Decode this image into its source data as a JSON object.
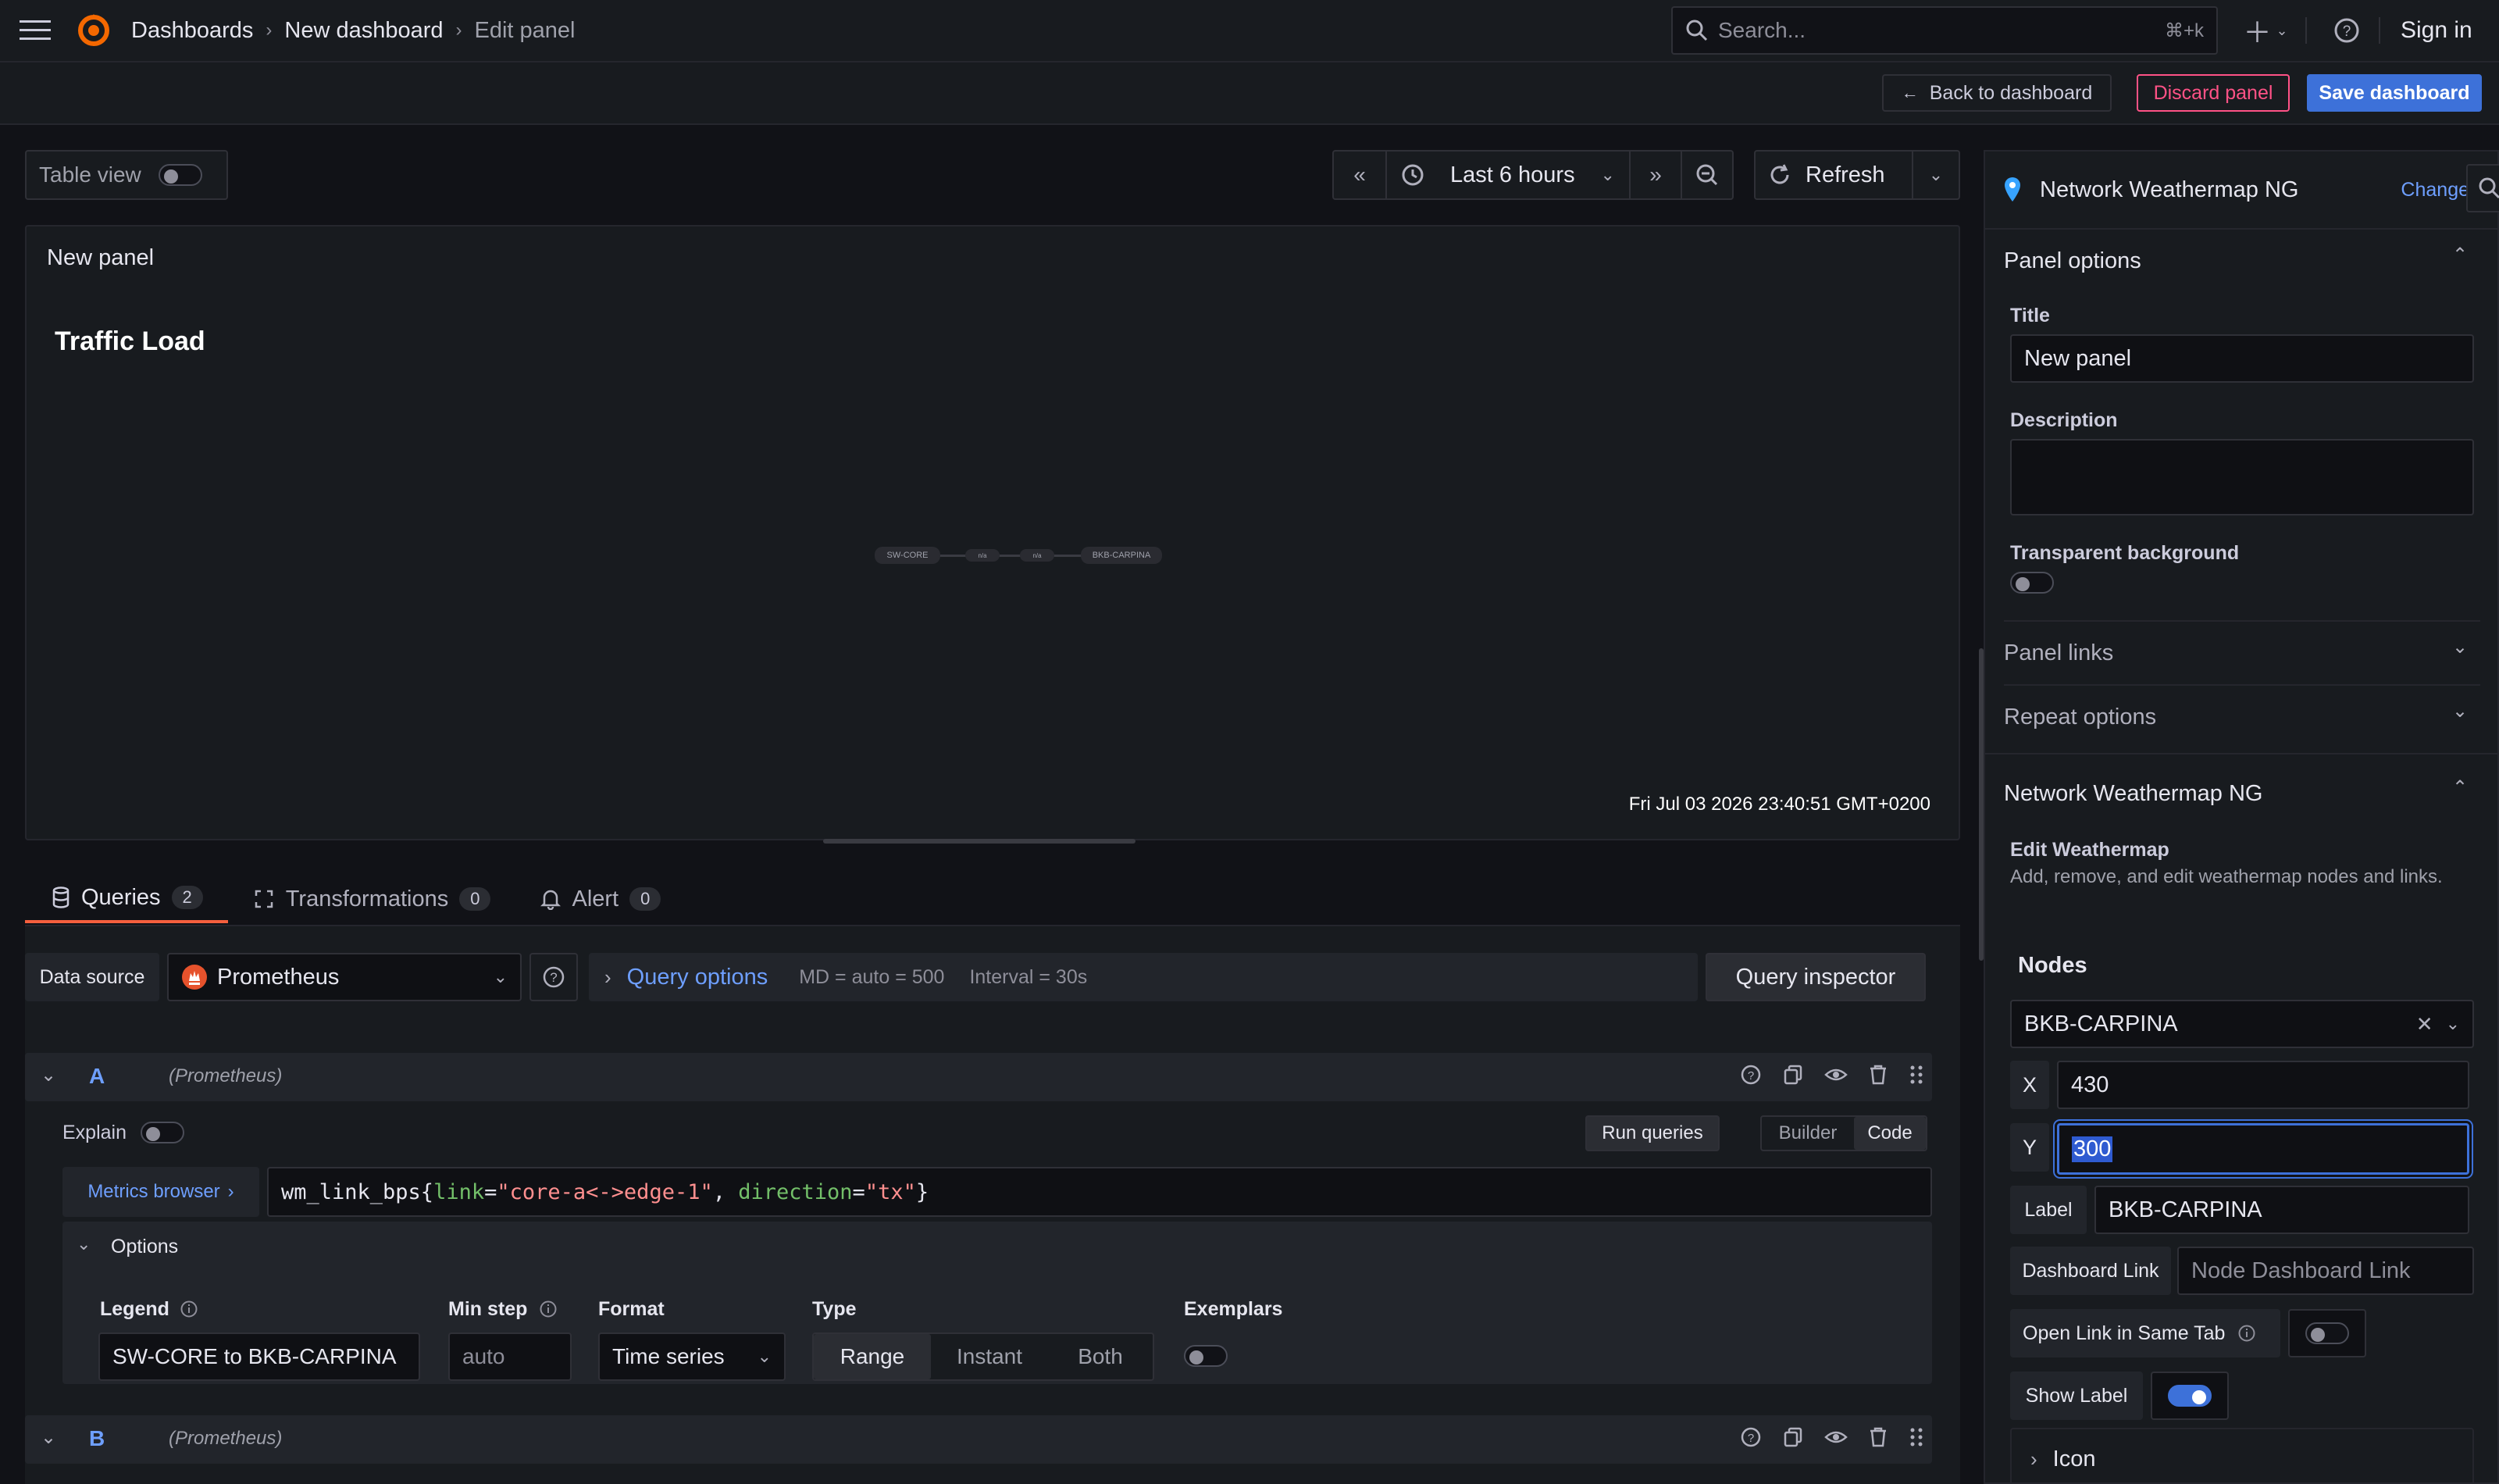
{
  "topbar": {
    "breadcrumb": [
      "Dashboards",
      "New dashboard",
      "Edit panel"
    ],
    "search_placeholder": "Search...",
    "search_shortcut": "⌘+k",
    "sign_in": "Sign in"
  },
  "toolbar": {
    "back": "Back to dashboard",
    "discard": "Discard panel",
    "save": "Save dashboard"
  },
  "controls": {
    "table_view": "Table view",
    "time_range": "Last 6 hours",
    "refresh": "Refresh"
  },
  "panel": {
    "title": "New panel",
    "map_title": "Traffic Load",
    "nodes": [
      {
        "label": "SW-CORE"
      },
      {
        "label": "BKB-CARPINA"
      }
    ],
    "link_labels": [
      "n/a",
      "n/a"
    ],
    "timestamp": "Fri Jul 03 2026 23:40:51 GMT+0200"
  },
  "tabs": [
    {
      "label": "Queries",
      "count": "2"
    },
    {
      "label": "Transformations",
      "count": "0"
    },
    {
      "label": "Alert",
      "count": "0"
    }
  ],
  "datasource": {
    "label": "Data source",
    "value": "Prometheus",
    "query_options": "Query options",
    "md": "MD = auto = 500",
    "interval": "Interval = 30s",
    "inspector": "Query inspector"
  },
  "query_a": {
    "ref": "A",
    "source": "(Prometheus)",
    "explain": "Explain",
    "run": "Run queries",
    "builder": "Builder",
    "code": "Code",
    "metrics_browser": "Metrics browser",
    "expr_parts": {
      "metric": "wm_link_bps{",
      "k1": "link",
      "eq1": "=",
      "v1": "\"core-a<->edge-1\"",
      "comma": ", ",
      "k2": "direction",
      "eq2": "=",
      "v2": "\"tx\"",
      "close": "}"
    },
    "options_label": "Options",
    "legend_label": "Legend",
    "legend_value": "SW-CORE to BKB-CARPINA",
    "minstep_label": "Min step",
    "minstep_placeholder": "auto",
    "format_label": "Format",
    "format_value": "Time series",
    "type_label": "Type",
    "type_options": [
      "Range",
      "Instant",
      "Both"
    ],
    "exemplars_label": "Exemplars"
  },
  "query_b": {
    "ref": "B",
    "source": "(Prometheus)"
  },
  "side": {
    "viz_name": "Network Weathermap NG",
    "change": "Change",
    "panel_options": "Panel options",
    "title_label": "Title",
    "title_value": "New panel",
    "description_label": "Description",
    "transparent_label": "Transparent background",
    "panel_links": "Panel links",
    "repeat_options": "Repeat options",
    "section": "Network Weathermap NG",
    "edit_title": "Edit Weathermap",
    "edit_desc": "Add, remove, and edit weathermap nodes and links.",
    "nodes_title": "Nodes",
    "node_select": "BKB-CARPINA",
    "x_label": "X",
    "x_value": "430",
    "y_label": "Y",
    "y_value": "300",
    "label_label": "Label",
    "label_value": "BKB-CARPINA",
    "dash_link_label": "Dashboard Link",
    "dash_link_placeholder": "Node Dashboard Link",
    "same_tab_label": "Open Link in Same Tab",
    "show_label": "Show Label",
    "icon_label": "Icon"
  },
  "colors": {
    "bg": "#111217",
    "panel": "#181b1f",
    "accent": "#3d71d9",
    "link": "#6e9fff",
    "danger": "#ff5286",
    "tab_underline": "#f55f3e"
  }
}
